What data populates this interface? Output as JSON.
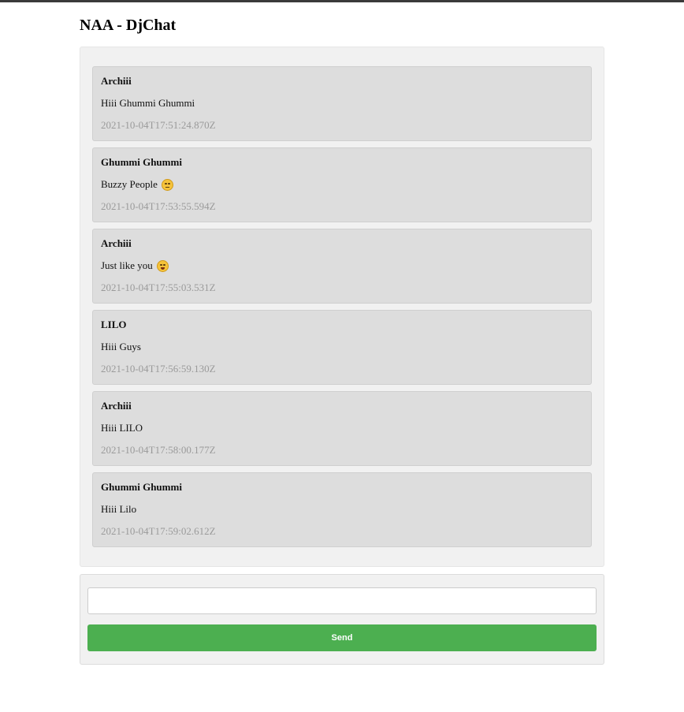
{
  "header": {
    "title": "NAA - DjChat"
  },
  "messages": [
    {
      "user": "Archiii",
      "text": "Hiii Ghummi Ghummi",
      "emoji": "",
      "time": "2021-10-04T17:51:24.870Z"
    },
    {
      "user": "Ghummi Ghummi",
      "text": "Buzzy People",
      "emoji": "unamused-face-icon",
      "time": "2021-10-04T17:53:55.594Z"
    },
    {
      "user": "Archiii",
      "text": "Just like you",
      "emoji": "laughing-face-icon",
      "time": "2021-10-04T17:55:03.531Z"
    },
    {
      "user": "LILO",
      "text": "Hiii Guys",
      "emoji": "",
      "time": "2021-10-04T17:56:59.130Z"
    },
    {
      "user": "Archiii",
      "text": "Hiii LILO",
      "emoji": "",
      "time": "2021-10-04T17:58:00.177Z"
    },
    {
      "user": "Ghummi Ghummi",
      "text": "Hiii Lilo",
      "emoji": "",
      "time": "2021-10-04T17:59:02.612Z"
    }
  ],
  "composer": {
    "input_value": "",
    "input_placeholder": "",
    "send_label": "Send"
  },
  "colors": {
    "send_button": "#4caf50",
    "message_bg": "#dddddd",
    "panel_bg": "#f1f1f1",
    "timestamp": "#9a9a9a"
  }
}
